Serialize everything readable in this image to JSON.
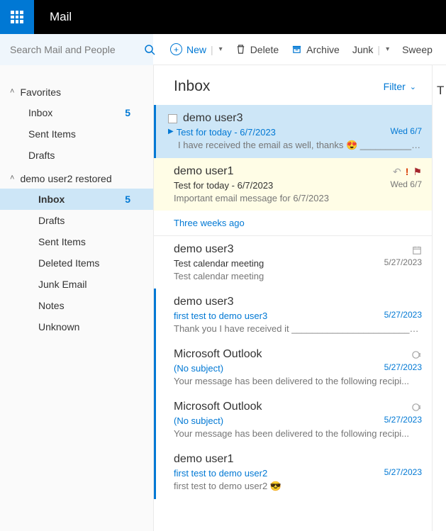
{
  "header": {
    "app_title": "Mail"
  },
  "search": {
    "placeholder": "Search Mail and People"
  },
  "toolbar": {
    "new": "New",
    "delete": "Delete",
    "archive": "Archive",
    "junk": "Junk",
    "sweep": "Sweep"
  },
  "sidebar": {
    "favorites": {
      "label": "Favorites",
      "items": [
        {
          "label": "Inbox",
          "count": "5"
        },
        {
          "label": "Sent Items"
        },
        {
          "label": "Drafts"
        }
      ]
    },
    "account": {
      "label": "demo user2 restored",
      "items": [
        {
          "label": "Inbox",
          "count": "5"
        },
        {
          "label": "Drafts"
        },
        {
          "label": "Sent Items"
        },
        {
          "label": "Deleted Items"
        },
        {
          "label": "Junk Email"
        },
        {
          "label": "Notes"
        },
        {
          "label": "Unknown"
        }
      ]
    }
  },
  "inbox": {
    "title": "Inbox",
    "filter": "Filter",
    "time_separator": "Three weeks ago"
  },
  "messages": [
    {
      "sender": "demo user3",
      "subject": "Test for today - 6/7/2023",
      "preview": "I have received the email as well, thanks 😍 _____________...",
      "date": "Wed 6/7"
    },
    {
      "sender": "demo user1",
      "subject": "Test for today - 6/7/2023",
      "preview": "Important email message for 6/7/2023",
      "date": "Wed 6/7"
    },
    {
      "sender": "demo user3",
      "subject": "Test calendar meeting",
      "preview": "Test calendar meeting",
      "date": "5/27/2023"
    },
    {
      "sender": "demo user3",
      "subject": "first test to demo user3",
      "preview": "Thank you I have received it ____________________________...",
      "date": "5/27/2023"
    },
    {
      "sender": "Microsoft Outlook",
      "subject": "(No subject)",
      "preview": "Your message has been delivered to the following recipi...",
      "date": "5/27/2023"
    },
    {
      "sender": "Microsoft Outlook",
      "subject": "(No subject)",
      "preview": "Your message has been delivered to the following recipi...",
      "date": "5/27/2023"
    },
    {
      "sender": "demo user1",
      "subject": "first test to demo user2",
      "preview": "first test to demo user2 😎",
      "date": "5/27/2023"
    }
  ],
  "right": {
    "initial": "T"
  }
}
